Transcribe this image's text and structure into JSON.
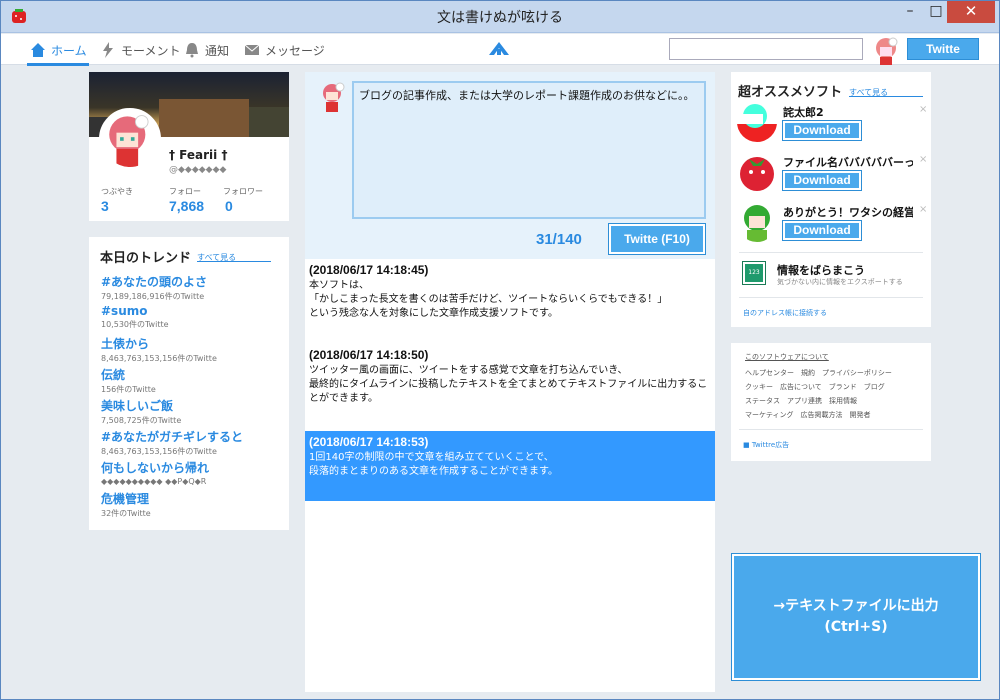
{
  "window": {
    "title": "文は書けぬが呟ける",
    "minimize": "–",
    "maximize": "□",
    "close": "✕"
  },
  "nav": {
    "home": "ホーム",
    "moments": "モーメント",
    "notifications": "通知",
    "messages": "メッセージ",
    "search_value": "",
    "twitte_label": "Twitte"
  },
  "profile": {
    "name": "† Fearii †",
    "handle": "@◆◆◆◆◆◆◆",
    "tweets_label": "つぶやき",
    "tweets_count": "3",
    "following_label": "フォロー",
    "following_count": "7,868",
    "followers_label": "フォロワー",
    "followers_count": "0"
  },
  "trends": {
    "title": "本日のトレンド",
    "see_all": "すべて見る",
    "items": [
      {
        "tag": "#あなたの頭のよさ",
        "meta": "79,189,186,916件のTwitte"
      },
      {
        "tag": "#sumo",
        "meta": "10,530件のTwitte"
      },
      {
        "tag": "土俵から",
        "meta": "8,463,763,153,156件のTwitte"
      },
      {
        "tag": "伝統",
        "meta": "156件のTwitte"
      },
      {
        "tag": "美味しいご飯",
        "meta": "7,508,725件のTwitte"
      },
      {
        "tag": "#あなたがガチギレすると",
        "meta": "8,463,763,153,156件のTwitte"
      },
      {
        "tag": "何もしないから帰れ",
        "meta": "◆◆◆◆◆◆◆◆◆◆ ◆◆P◆Q◆R"
      },
      {
        "tag": "危機管理",
        "meta": "32件のTwitte"
      }
    ]
  },
  "compose": {
    "text": "ブログの記事作成、または大学のレポート課題作成のお供などに。。",
    "counter": "31/140",
    "button": "Twitte (F10)"
  },
  "timeline": [
    {
      "time": "(2018/06/17 14:18:45)",
      "body": "本ソフトは、\n「かしこまった長文を書くのは苦手だけど、ツイートならいくらでもできる！」\nという残念な人を対象にした文章作成支援ソフトです。",
      "selected": false
    },
    {
      "time": "(2018/06/17 14:18:50)",
      "body": "ツイッター風の画面に、ツイートをする感覚で文章を打ち込んでいき、\n最終的にタイムラインに投稿したテキストを全てまとめてテキストファイルに出力することができます。",
      "selected": false
    },
    {
      "time": "(2018/06/17 14:18:53)",
      "body": "1回140字の制限の中で文章を組み立てていくことで、\n段落的まとまりのある文章を作成することができます。",
      "selected": true
    }
  ],
  "recommend": {
    "title": "超オススメソフト",
    "see_all": "すべて見る",
    "items": [
      {
        "name": "詫太郎2",
        "button": "Download"
      },
      {
        "name": "ファイル名バババババーっ…",
        "button": "Download"
      },
      {
        "name": "ありがとう！ワタシの経営",
        "button": "Download"
      }
    ],
    "close": "×",
    "info_title": "情報をばらまこう",
    "info_icon_text": "123",
    "info_sub": "気づかない内に情報をエクスポートする",
    "addr_link": "自のアドレス帳に接続する"
  },
  "footer": {
    "about": "このソフトウェアについて",
    "links": [
      "ヘルプセンター　規約　プライバシーポリシー",
      "クッキー　広告について　ブランド　ブログ",
      "ステータス　アプリ連携　採用情報",
      "マーケティング　広告掲載方法　開発者"
    ],
    "ad": "■ Twittre広告"
  },
  "export": {
    "line1": "→テキストファイルに出力",
    "line2": "(Ctrl+S)"
  },
  "colors": {
    "accent": "#2a8ae0",
    "button": "#4aa9ec",
    "selected": "#3399ff",
    "background": "#e6ebf0"
  }
}
